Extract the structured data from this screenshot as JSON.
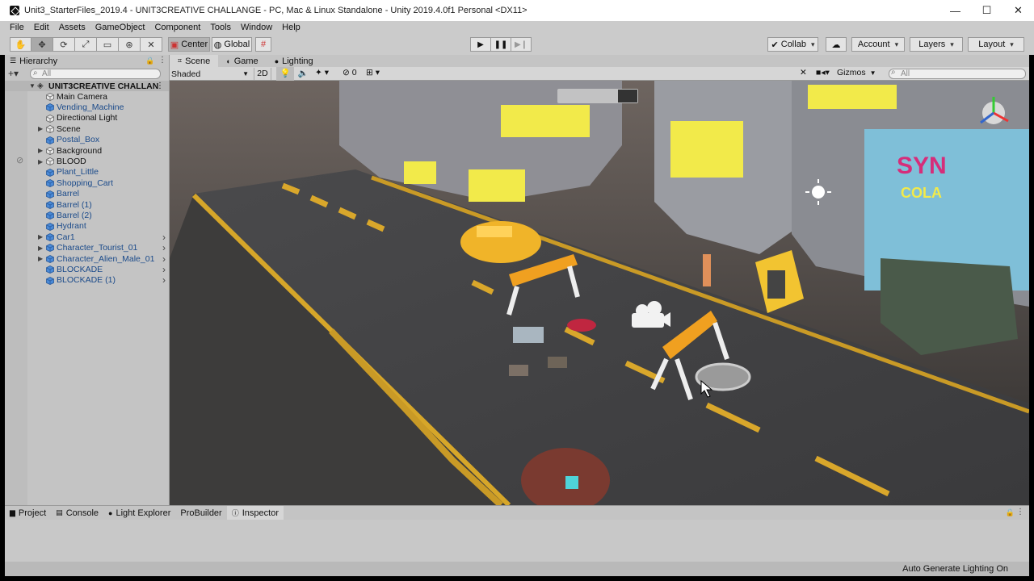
{
  "window": {
    "title": "Unit3_StarterFiles_2019.4 - UNIT3CREATIVE CHALLANGE - PC, Mac & Linux Standalone - Unity 2019.4.0f1 Personal <DX11>",
    "minimize": "—",
    "maximize": "☐",
    "close": "✕"
  },
  "menu": [
    "File",
    "Edit",
    "Assets",
    "GameObject",
    "Component",
    "Tools",
    "Window",
    "Help"
  ],
  "toolbar": {
    "tools": [
      "hand-tool-icon",
      "move-tool-icon",
      "rotate-tool-icon",
      "scale-tool-icon",
      "rect-tool-icon",
      "transform-tool-icon",
      "custom-tool-icon"
    ],
    "tool_glyphs": [
      "✋",
      "✥",
      "⟳",
      "⤢",
      "▭",
      "⊛",
      "✕"
    ],
    "active_tool": 1,
    "pivot": "Center",
    "space": "Global",
    "collab": "Collab",
    "account": "Account",
    "layers": "Layers",
    "layout": "Layout"
  },
  "hierarchy": {
    "tab": "Hierarchy",
    "search_placeholder": "All",
    "scene_name": "UNIT3CREATIVE CHALLAN",
    "items": [
      {
        "label": "Main Camera",
        "prefab": false,
        "expandable": false,
        "more": false
      },
      {
        "label": "Vending_Machine",
        "prefab": true,
        "expandable": false,
        "more": false
      },
      {
        "label": "Directional Light",
        "prefab": false,
        "expandable": false,
        "more": false
      },
      {
        "label": "Scene",
        "prefab": false,
        "expandable": true,
        "more": false
      },
      {
        "label": "Postal_Box",
        "prefab": true,
        "expandable": false,
        "more": false
      },
      {
        "label": "Background",
        "prefab": false,
        "expandable": true,
        "more": false
      },
      {
        "label": "BLOOD",
        "prefab": false,
        "expandable": true,
        "more": false
      },
      {
        "label": "Plant_Little",
        "prefab": true,
        "expandable": false,
        "more": false
      },
      {
        "label": "Shopping_Cart",
        "prefab": true,
        "expandable": false,
        "more": false
      },
      {
        "label": "Barrel",
        "prefab": true,
        "expandable": false,
        "more": false
      },
      {
        "label": "Barrel (1)",
        "prefab": true,
        "expandable": false,
        "more": false
      },
      {
        "label": "Barrel (2)",
        "prefab": true,
        "expandable": false,
        "more": false
      },
      {
        "label": "Hydrant",
        "prefab": true,
        "expandable": false,
        "more": false
      },
      {
        "label": "Car1",
        "prefab": true,
        "expandable": true,
        "more": true
      },
      {
        "label": "Character_Tourist_01",
        "prefab": true,
        "expandable": true,
        "more": true
      },
      {
        "label": "Character_Alien_Male_01",
        "prefab": true,
        "expandable": true,
        "more": true
      },
      {
        "label": "BLOCKADE",
        "prefab": true,
        "expandable": false,
        "more": true
      },
      {
        "label": "BLOCKADE (1)",
        "prefab": true,
        "expandable": false,
        "more": true
      }
    ]
  },
  "scene_view": {
    "tabs": [
      "Scene",
      "Game",
      "Lighting"
    ],
    "active_tab": 0,
    "shading_mode": "Shaded",
    "mode_2d": "2D",
    "hidden_count": "0",
    "gizmos": "Gizmos",
    "search_placeholder": "All",
    "billboard_text": "SYN",
    "billboard_sub": "COLA"
  },
  "bottom_tabs": [
    "Project",
    "Console",
    "Light Explorer",
    "ProBuilder",
    "Inspector"
  ],
  "bottom_active": 4,
  "status": "Auto Generate Lighting On"
}
